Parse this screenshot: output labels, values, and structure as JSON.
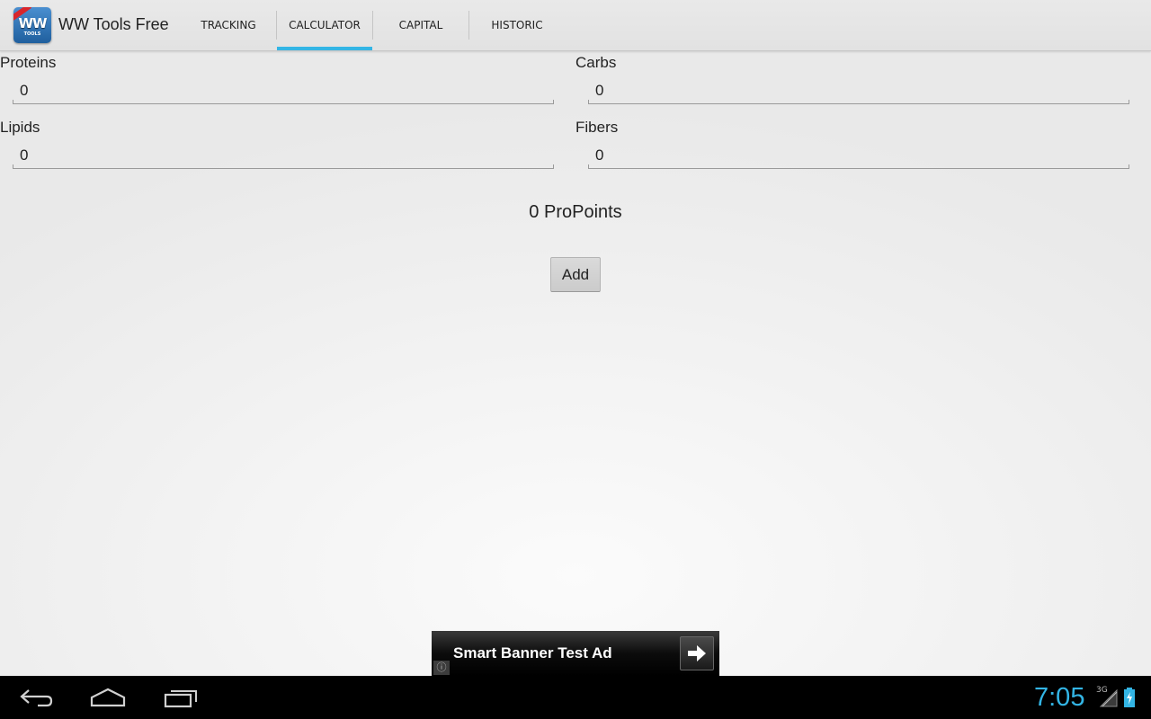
{
  "app": {
    "title": "WW Tools Free",
    "icon_name": "ww-tools-app-icon",
    "icon_text": "WW",
    "icon_subtext": "TOOLS"
  },
  "tabs": [
    {
      "label": "TRACKING",
      "selected": false
    },
    {
      "label": "CALCULATOR",
      "selected": true
    },
    {
      "label": "CAPITAL",
      "selected": false
    },
    {
      "label": "HISTORIC",
      "selected": false
    }
  ],
  "form": {
    "proteins": {
      "label": "Proteins",
      "value": "0"
    },
    "carbs": {
      "label": "Carbs",
      "value": "0"
    },
    "lipids": {
      "label": "Lipids",
      "value": "0"
    },
    "fibers": {
      "label": "Fibers",
      "value": "0"
    }
  },
  "result": {
    "points_text": "0 ProPoints"
  },
  "actions": {
    "add_label": "Add"
  },
  "ad": {
    "text": "Smart Banner Test Ad",
    "info_glyph": "ⓘ",
    "arrow_icon": "right-arrow-icon"
  },
  "status": {
    "time": "7:05",
    "network": "3G",
    "icons": [
      "signal-icon",
      "battery-charging-icon"
    ]
  },
  "colors": {
    "accent": "#33b5e5",
    "action_bar": "#e4e4e4",
    "nav_bar": "#000000"
  }
}
